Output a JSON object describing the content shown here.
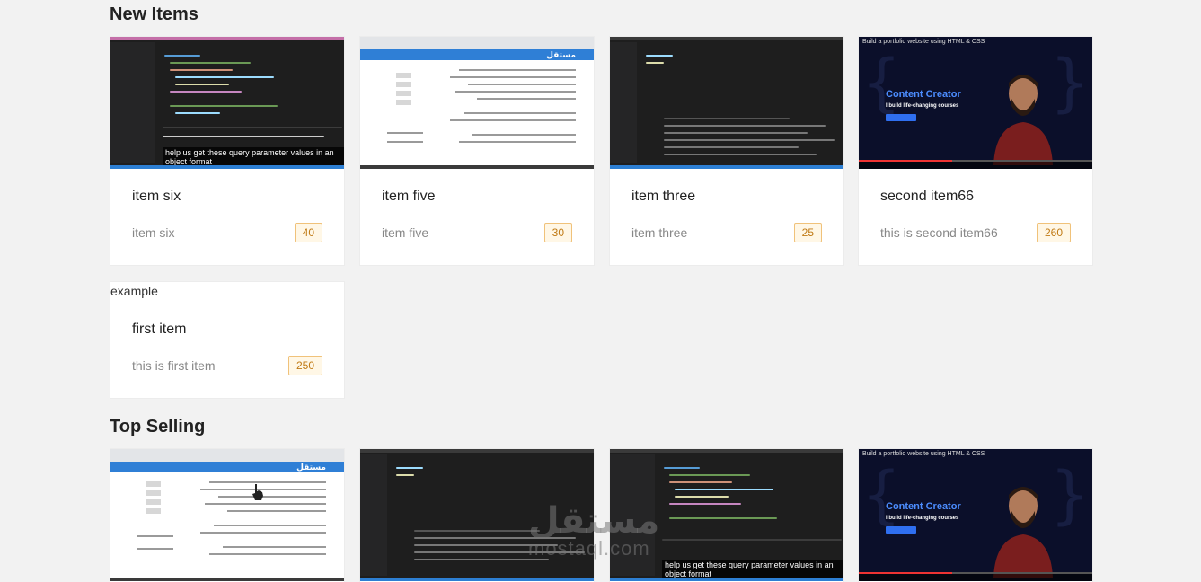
{
  "sections": {
    "new_items": {
      "title": "New Items",
      "items": [
        {
          "title": "item six",
          "description": "item six",
          "price": "40",
          "thumbnail": "ide-screenshot",
          "caption": "help us get these query parameter values in an object format"
        },
        {
          "title": "item five",
          "description": "item five",
          "price": "30",
          "thumbnail": "browser-screenshot",
          "logo": "مستقل"
        },
        {
          "title": "item three",
          "description": "item three",
          "price": "25",
          "thumbnail": "ide-screenshot"
        },
        {
          "title": "second item66",
          "description": "this is second item66",
          "price": "260",
          "thumbnail": "video-screenshot",
          "video_title": "Build a portfolio website using HTML & CSS",
          "video_heading": "Content Creator",
          "video_sub": "I build life-changing courses"
        },
        {
          "title": "first item",
          "description": "this is first item",
          "price": "250",
          "image_alt": "example"
        }
      ]
    },
    "top_selling": {
      "title": "Top Selling",
      "items": [
        {
          "thumbnail": "browser-screenshot",
          "logo": "مستقل"
        },
        {
          "thumbnail": "ide-screenshot"
        },
        {
          "thumbnail": "ide-screenshot",
          "caption": "help us get these query parameter values in an object format"
        },
        {
          "thumbnail": "video-screenshot",
          "video_title": "Build a portfolio website using HTML & CSS",
          "video_heading": "Content Creator",
          "video_sub": "I build life-changing courses"
        }
      ]
    }
  },
  "watermark": {
    "arabic": "مستقل",
    "latin": "mostaql.com"
  },
  "colors": {
    "background": "#f2f2f2",
    "price_text": "#c07a14",
    "price_border": "#f0c27a",
    "price_bg": "#fff7e6"
  }
}
